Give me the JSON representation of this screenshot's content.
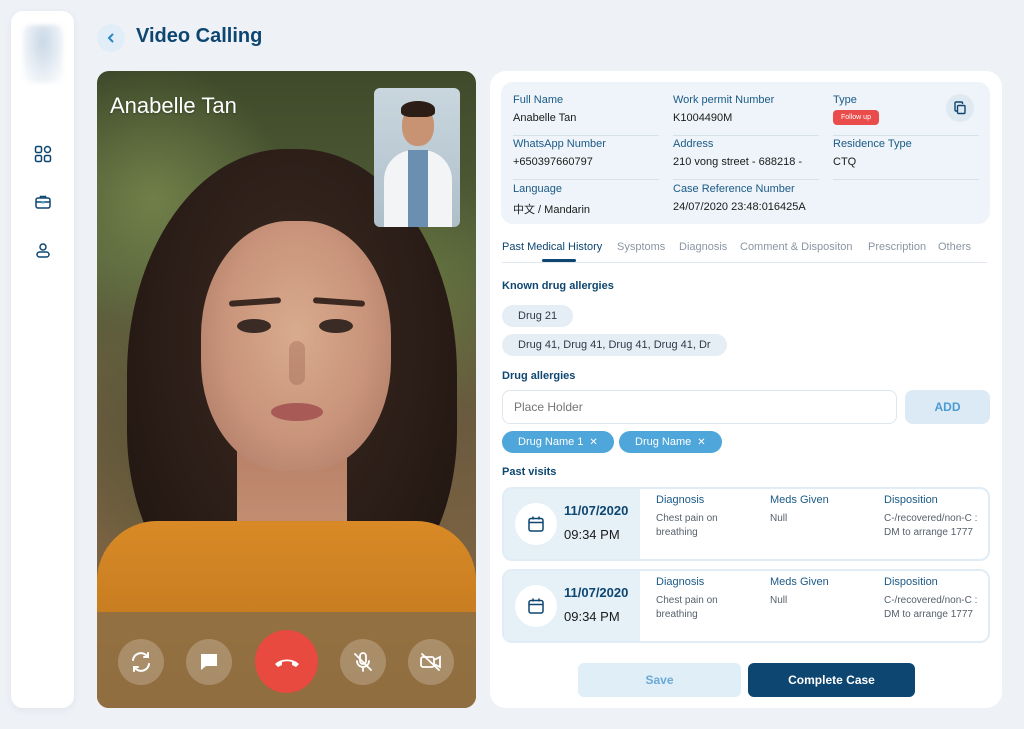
{
  "header": {
    "title": "Video Calling"
  },
  "sidebar": {
    "items": [
      {
        "icon": "dashboard-grid-icon"
      },
      {
        "icon": "briefcase-icon"
      },
      {
        "icon": "user-icon"
      }
    ]
  },
  "video": {
    "caller_name": "Anabelle Tan",
    "controls": [
      "switch-camera-icon",
      "chat-icon",
      "end-call-icon",
      "mic-off-icon",
      "video-off-icon"
    ],
    "end_call_color": "#e84a3f"
  },
  "patient": {
    "full_name_label": "Full Name",
    "full_name": "Anabelle Tan",
    "work_permit_label": "Work permit Number",
    "work_permit": "K1004490M",
    "type_label": "Type",
    "type_badge": "Follow up",
    "whatsapp_label": "WhatsApp Number",
    "whatsapp": "+650397660797",
    "address_label": "Address",
    "address": "210 vong street - 688218 -",
    "residence_label": "Residence Type",
    "residence": "CTQ",
    "language_label": "Language",
    "language": "中文 / Mandarin",
    "case_ref_label": "Case Reference Number",
    "case_ref": "24/07/2020 23:48:016425A"
  },
  "tabs": [
    "Past Medical History",
    "Sysptoms",
    "Diagnosis",
    "Comment & Dispositon",
    "Prescription",
    "Others"
  ],
  "known_allergies": {
    "title": "Known drug allergies",
    "chips": [
      "Drug 21",
      "Drug 41, Drug 41, Drug 41, Drug 41, Dr"
    ]
  },
  "drug_allergies": {
    "title": "Drug allergies",
    "placeholder": "Place Holder",
    "add_label": "ADD",
    "tags": [
      "Drug Name 1",
      "Drug Name"
    ],
    "remove_glyph": "✕"
  },
  "past_visits": {
    "title": "Past visits",
    "col_diagnosis": "Diagnosis",
    "col_meds": "Meds Given",
    "col_disposition": "Disposition",
    "visits": [
      {
        "date": "11/07/2020",
        "time": "09:34 PM",
        "diagnosis": "Chest pain on breathing",
        "meds": "Null",
        "disposition": "C-/recovered/non-C : DM to arrange 1777"
      },
      {
        "date": "11/07/2020",
        "time": "09:34 PM",
        "diagnosis": "Chest pain on breathing",
        "meds": "Null",
        "disposition": "C-/recovered/non-C : DM to arrange 1777"
      }
    ]
  },
  "actions": {
    "save": "Save",
    "complete": "Complete Case"
  },
  "colors": {
    "primary": "#0d4670",
    "accent": "#4ea6da",
    "badge": "#ea4b4b"
  }
}
